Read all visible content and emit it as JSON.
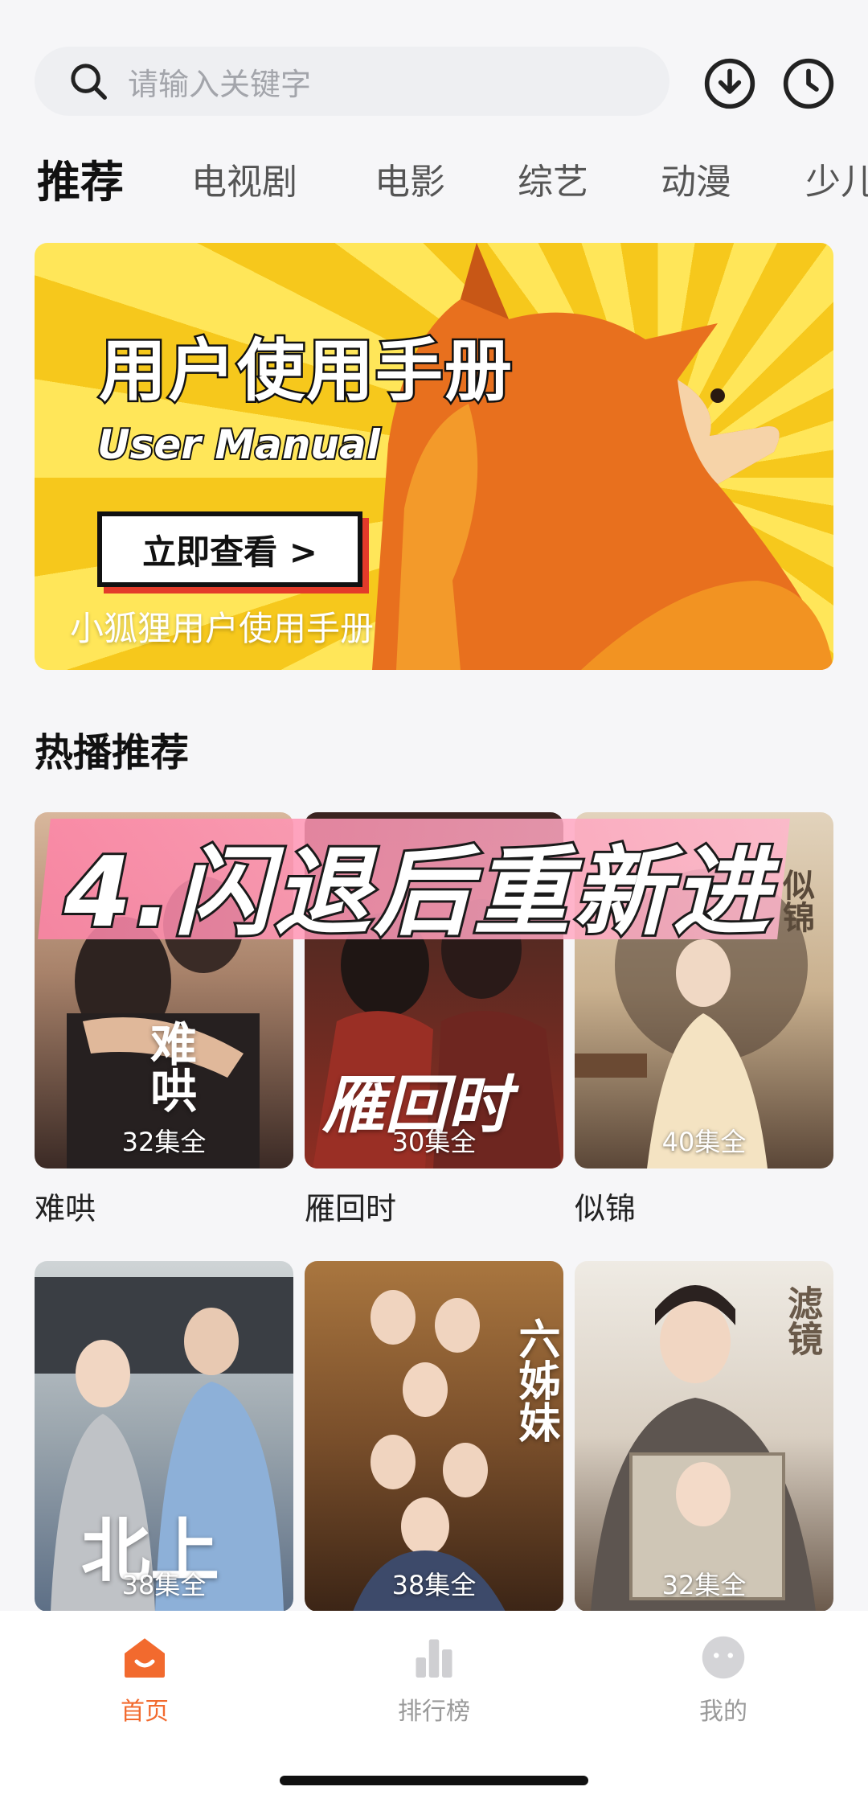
{
  "search": {
    "placeholder": "请输入关键字"
  },
  "header_icons": {
    "download": "download-icon",
    "history": "clock-icon"
  },
  "tabs": [
    {
      "label": "推荐",
      "active": true
    },
    {
      "label": "电视剧"
    },
    {
      "label": "电影"
    },
    {
      "label": "综艺"
    },
    {
      "label": "动漫"
    },
    {
      "label": "少儿"
    }
  ],
  "banner": {
    "title": "用户使用手册",
    "subtitle": "User Manual",
    "cta": "立即查看 >",
    "caption": "小狐狸用户使用手册"
  },
  "section": {
    "title": "热播推荐"
  },
  "overlay_caption": "4.闪退后重新进",
  "shows": [
    {
      "name": "难哄",
      "episodes": "32集全",
      "poster_text": "难哄",
      "palette": [
        "#cfa98f",
        "#3b2a25"
      ]
    },
    {
      "name": "雁回时",
      "episodes": "30集全",
      "poster_text": "雁回时",
      "palette": [
        "#4b2b25",
        "#8e2d22"
      ]
    },
    {
      "name": "似锦",
      "episodes": "40集全",
      "poster_text": "似锦",
      "palette": [
        "#d9c7ad",
        "#5b4738"
      ]
    },
    {
      "name": "",
      "episodes": "38集全",
      "poster_text": "北上",
      "palette": [
        "#c9cfd2",
        "#6e8fb4"
      ]
    },
    {
      "name": "",
      "episodes": "38集全",
      "poster_text": "六姊妹",
      "palette": [
        "#8c5a2e",
        "#3c2516"
      ]
    },
    {
      "name": "",
      "episodes": "32集全",
      "poster_text": "滤镜",
      "palette": [
        "#e8e3da",
        "#6b5a4c"
      ]
    }
  ],
  "bottom_nav": [
    {
      "label": "首页",
      "icon": "home-icon",
      "active": true
    },
    {
      "label": "排行榜",
      "icon": "chart-icon"
    },
    {
      "label": "我的",
      "icon": "profile-icon"
    }
  ],
  "colors": {
    "accent": "#f26a2e",
    "banner_yellow": "#f6c81c",
    "fox_orange": "#e8701e"
  }
}
